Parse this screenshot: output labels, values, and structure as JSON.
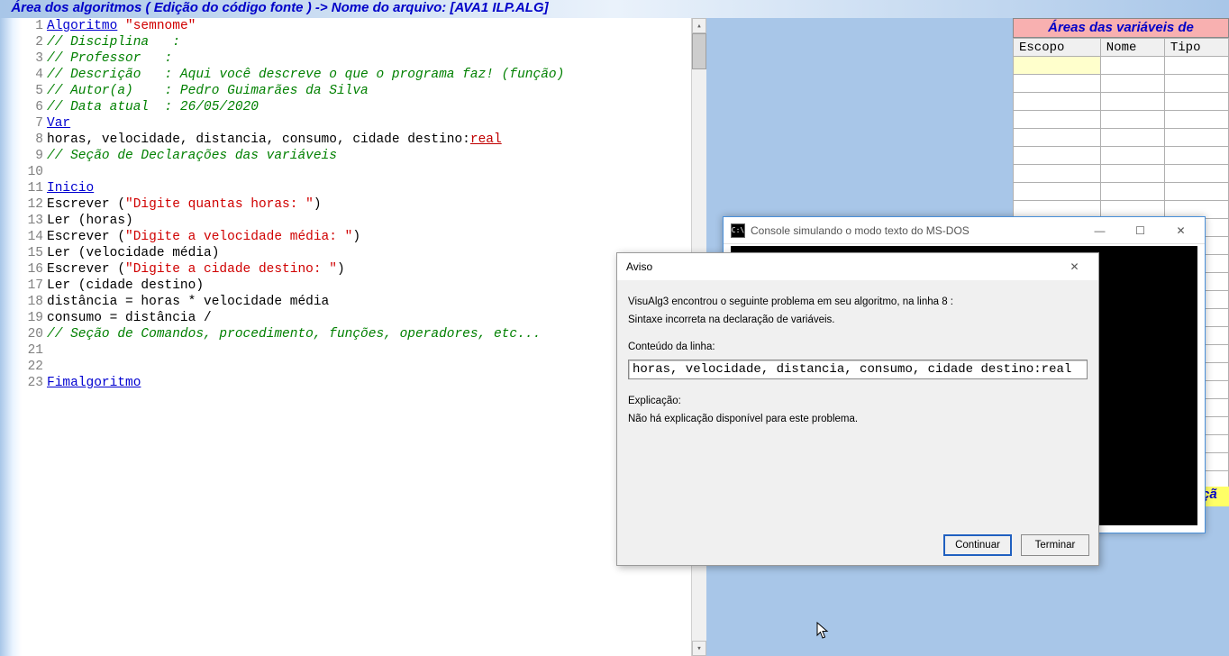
{
  "title_bar": "  Área dos algoritmos ( Edição do código fonte ) -> Nome do arquivo: [AVA1 ILP.ALG]",
  "code": {
    "lines": [
      {
        "n": 1,
        "segs": [
          {
            "t": "Algoritmo",
            "c": "u"
          },
          {
            "t": " ",
            "c": "p"
          },
          {
            "t": "\"semnome\"",
            "c": "s"
          }
        ]
      },
      {
        "n": 2,
        "segs": [
          {
            "t": "// Disciplina   :",
            "c": "c"
          }
        ]
      },
      {
        "n": 3,
        "segs": [
          {
            "t": "// Professor   :",
            "c": "c"
          }
        ]
      },
      {
        "n": 4,
        "segs": [
          {
            "t": "// Descrição   : Aqui você descreve o que o programa faz! (função)",
            "c": "c"
          }
        ]
      },
      {
        "n": 5,
        "segs": [
          {
            "t": "// Autor(a)    : Pedro Guimarães da Silva",
            "c": "c"
          }
        ]
      },
      {
        "n": 6,
        "segs": [
          {
            "t": "// Data atual  : 26/05/2020",
            "c": "c"
          }
        ]
      },
      {
        "n": 7,
        "segs": [
          {
            "t": "Var",
            "c": "u"
          }
        ]
      },
      {
        "n": 8,
        "segs": [
          {
            "t": "horas, velocidade, distancia, consumo, cidade destino:",
            "c": "p"
          },
          {
            "t": "real",
            "c": "t"
          }
        ]
      },
      {
        "n": 9,
        "segs": [
          {
            "t": "// Seção de Declarações das variáveis",
            "c": "c"
          }
        ]
      },
      {
        "n": 10,
        "segs": []
      },
      {
        "n": 11,
        "segs": [
          {
            "t": "Inicio",
            "c": "u"
          }
        ]
      },
      {
        "n": 12,
        "segs": [
          {
            "t": "Escrever (",
            "c": "p"
          },
          {
            "t": "\"Digite quantas horas: \"",
            "c": "s"
          },
          {
            "t": ")",
            "c": "p"
          }
        ]
      },
      {
        "n": 13,
        "segs": [
          {
            "t": "Ler (horas)",
            "c": "p"
          }
        ]
      },
      {
        "n": 14,
        "segs": [
          {
            "t": "Escrever (",
            "c": "p"
          },
          {
            "t": "\"Digite a velocidade média: \"",
            "c": "s"
          },
          {
            "t": ")",
            "c": "p"
          }
        ]
      },
      {
        "n": 15,
        "segs": [
          {
            "t": "Ler (velocidade média)",
            "c": "p"
          }
        ]
      },
      {
        "n": 16,
        "segs": [
          {
            "t": "Escrever (",
            "c": "p"
          },
          {
            "t": "\"Digite a cidade destino: \"",
            "c": "s"
          },
          {
            "t": ")",
            "c": "p"
          }
        ]
      },
      {
        "n": 17,
        "segs": [
          {
            "t": "Ler (cidade destino)",
            "c": "p"
          }
        ]
      },
      {
        "n": 18,
        "segs": [
          {
            "t": "distância = horas * velocidade média",
            "c": "p"
          }
        ]
      },
      {
        "n": 19,
        "segs": [
          {
            "t": "consumo = distância /",
            "c": "p"
          }
        ]
      },
      {
        "n": 20,
        "segs": [
          {
            "t": "// Seção de Comandos, procedimento, funções, operadores, etc...",
            "c": "c"
          }
        ]
      },
      {
        "n": 21,
        "segs": []
      },
      {
        "n": 22,
        "segs": []
      },
      {
        "n": 23,
        "segs": [
          {
            "t": "Fimalgoritmo",
            "c": "u"
          }
        ]
      }
    ]
  },
  "vars_panel": {
    "title": "Áreas das variáveis de",
    "headers": [
      "Escopo",
      "Nome",
      "Tipo"
    ],
    "rows": 24
  },
  "yellow_strip": "çã",
  "console": {
    "title": "Console simulando o modo texto do MS-DOS",
    "icon_text": "C:\\"
  },
  "aviso": {
    "title": "Aviso",
    "line1": "VisuAlg3 encontrou o seguinte problema em seu algoritmo, na linha 8 :",
    "line2": "Sintaxe incorreta na declaração de variáveis.",
    "conteudo_label": "Conteúdo da linha:",
    "conteudo_value": "horas, velocidade, distancia, consumo, cidade destino:real",
    "explicacao_label": "Explicação:",
    "explicacao_value": "Não há explicação disponível para este problema.",
    "btn_continue": "Continuar",
    "btn_terminate": "Terminar"
  }
}
